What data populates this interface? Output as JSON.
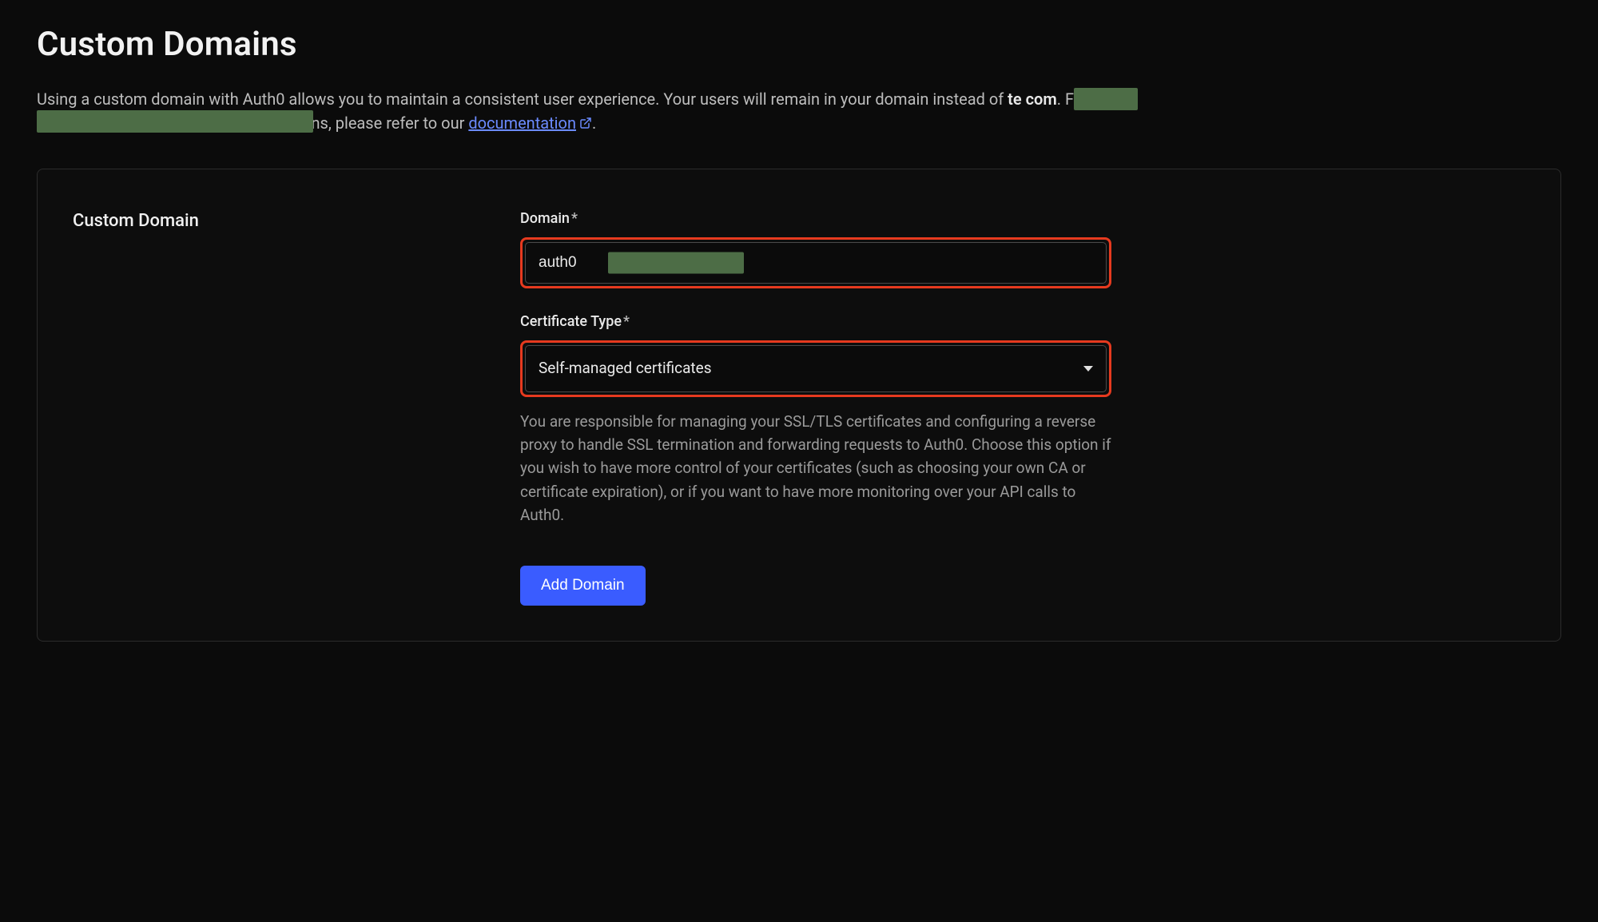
{
  "header": {
    "title": "Custom Domains",
    "desc_1": "Using a custom domain with Auth0 allows you to maintain a consistent user experience. Your users will remain in your domain instead of ",
    "desc_bold_prefix": "te",
    "desc_bold_suffix": "com",
    "desc_2": ". For more information about custom domains, please refer to our ",
    "doc_link_label": "documentation",
    "desc_3": "."
  },
  "colors": {
    "redaction": "#4d6d46",
    "highlight_border": "#e63a1f",
    "primary_button": "#3a5cff",
    "link": "#6b8bff"
  },
  "form": {
    "section_title": "Custom Domain",
    "domain": {
      "label": "Domain",
      "required_mark": "*",
      "value": "auth0                                click"
    },
    "cert_type": {
      "label": "Certificate Type",
      "required_mark": "*",
      "selected": "Self-managed certificates",
      "help": "You are responsible for managing your SSL/TLS certificates and configuring a reverse proxy to handle SSL termination and forwarding requests to Auth0. Choose this option if you wish to have more control of your certificates (such as choosing your own CA or certificate expiration), or if you want to have more monitoring over your API calls to Auth0."
    },
    "submit_label": "Add Domain"
  }
}
